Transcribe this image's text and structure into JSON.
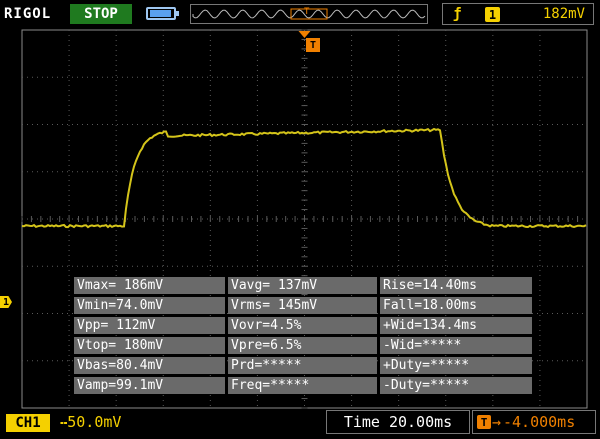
{
  "header": {
    "brand": "RIGOL",
    "run_status": "STOP",
    "trigger_channel": "1",
    "trigger_level": "182mV"
  },
  "channel": {
    "label": "CH1",
    "scale": "50.0mV",
    "ground_marker": "1"
  },
  "timebase": {
    "time": "Time 20.00ms",
    "offset": "-4.000ms",
    "trigger_marker": "T"
  },
  "measurements": [
    [
      "Vmax= 186mV",
      "Vavg= 137mV",
      "Rise=14.40ms"
    ],
    [
      "Vmin=74.0mV",
      "Vrms= 145mV",
      "Fall=18.00ms"
    ],
    [
      "Vpp= 112mV",
      "Vovr=4.5%",
      "+Wid=134.4ms"
    ],
    [
      "Vtop= 180mV",
      "Vpre=6.5%",
      "-Wid=*****"
    ],
    [
      "Vbas=80.4mV",
      "Prd=*****",
      "+Duty=*****"
    ],
    [
      "Vamp=99.1mV",
      "Freq=*****",
      "-Duty=*****"
    ]
  ],
  "waveform": {
    "color": "#d4c41a",
    "timebase_s_per_div": 0.02,
    "volts_per_div": 0.05,
    "baseline_mV": 80.4,
    "top_mV": 180,
    "rise_time_ms": 14.4,
    "fall_time_ms": 18.0,
    "positive_width_ms": 134.4
  },
  "colors": {
    "ch1": "#f5d000",
    "trigger": "#f08000",
    "stop_bg": "#1f7a1f",
    "grid": "#5a5a5a",
    "meas_bg": "#6a6a6a"
  }
}
